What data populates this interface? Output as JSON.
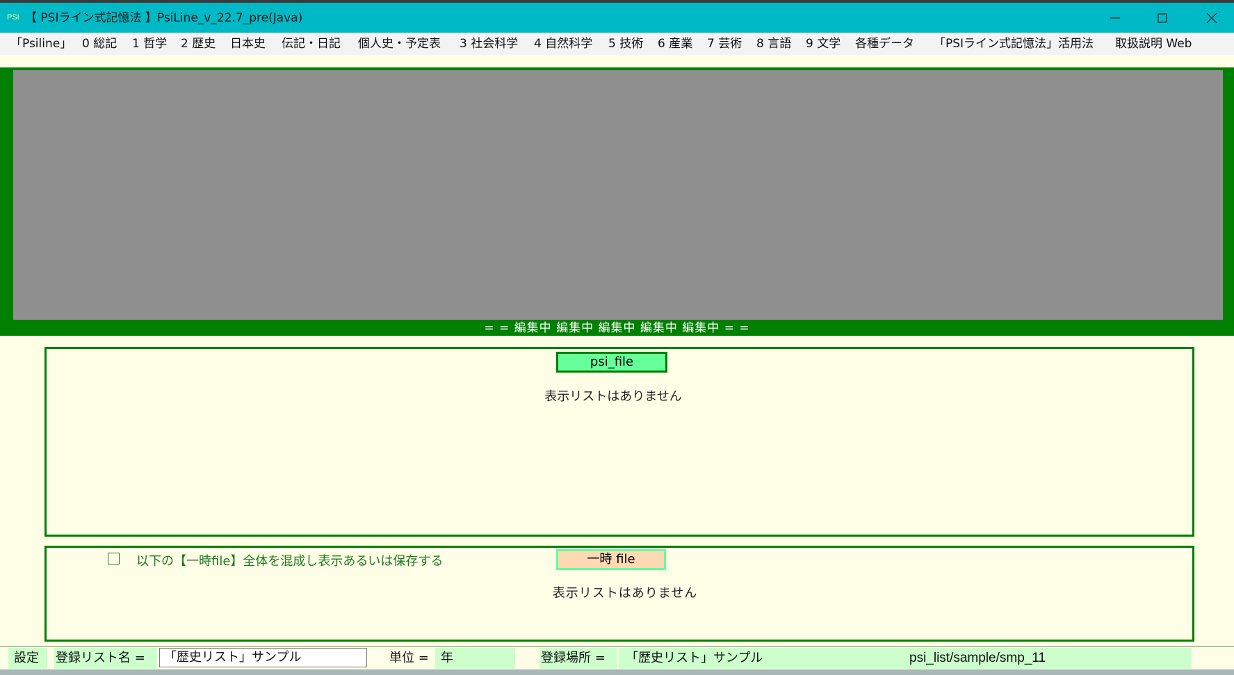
{
  "window": {
    "icon_text": "PSI",
    "title": "【 PSIライン式記憶法 】PsiLine_v_22.7_pre(Java)"
  },
  "menu": [
    "「Psiline」",
    "0 総記",
    "1 哲学",
    "2 歴史",
    "日本史",
    "伝記・日記",
    "個人史・予定表",
    "3 社会科学",
    "4 自然科学",
    "5 技術",
    "6 産業",
    "7 芸術",
    "8 言語",
    "9 文学",
    "各種データ",
    "「PSIライン式記憶法」活用法",
    "取扱説明 Web"
  ],
  "editing_banner": "= = 編集中 編集中 編集中 編集中 編集中 = =",
  "psi_panel": {
    "button_label": "psi_file",
    "empty_message": "表示リストはありません"
  },
  "temp_panel": {
    "checkbox_label": "以下の【一時file】全体を混成し表示あるいは保存する",
    "button_label": "一時 file",
    "empty_message": "表示リストはありません"
  },
  "status": {
    "settings_label": "設定",
    "list_name_label": "登録リスト名 =",
    "list_name_value": "「歴史リスト」サンプル",
    "unit_label": "単位 =",
    "unit_value": "年",
    "location_label": "登録場所 =",
    "location_value": "「歴史リスト」サンプル",
    "path_value": "psi_list/sample/smp_11"
  },
  "colors": {
    "titlebar": "#00b9c6",
    "frame_green": "#008000",
    "panel_gray": "#8f8f8f",
    "background": "#ffffe8",
    "psi_button": "#66ff99",
    "temp_button": "#ffd9b3",
    "status_field": "#ccffcc"
  }
}
